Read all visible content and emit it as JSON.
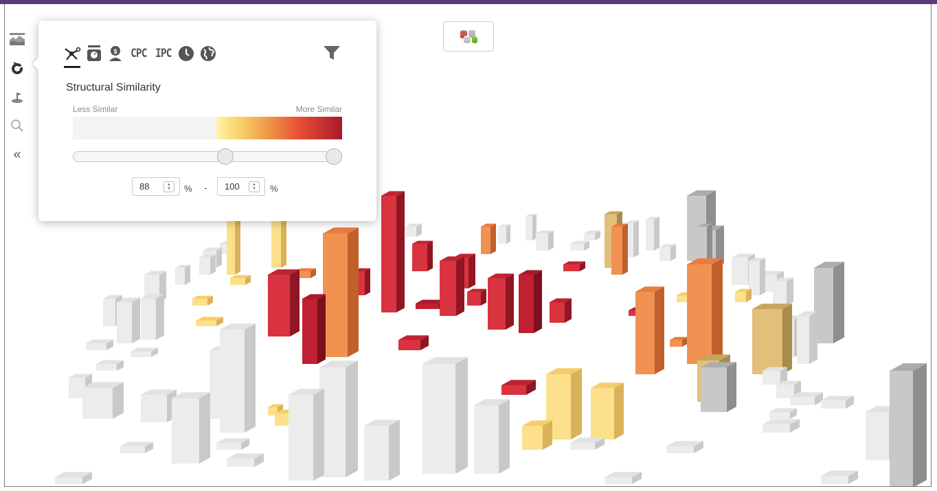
{
  "toolbar": {
    "left_rail": [
      "landscape-icon",
      "similarity-icon",
      "pin-icon",
      "search-icon",
      "collapse-icon"
    ],
    "collapse_glyph": "«"
  },
  "panel": {
    "tabs": [
      {
        "type": "icon",
        "icon": "molecule-structure-icon",
        "active": true
      },
      {
        "type": "icon",
        "icon": "weight-scale-icon"
      },
      {
        "type": "icon",
        "icon": "applicant-icon"
      },
      {
        "type": "text",
        "label": "CPC"
      },
      {
        "type": "text",
        "label": "IPC"
      },
      {
        "type": "icon",
        "icon": "clock-icon"
      },
      {
        "type": "icon",
        "icon": "globe-icon"
      }
    ],
    "filter_icon": "funnel-icon",
    "title": "Structural Similarity",
    "legend_left": "Less Similar",
    "legend_right": "More Similar",
    "colors": {
      "low": "#fdf3a8",
      "mid": "#f09448",
      "high": "#a8192b",
      "neutral": "#f3f3f3"
    },
    "slider": {
      "min_percent": 88,
      "max_percent": 100
    },
    "range_from": "88",
    "range_to": "100",
    "unit": "%",
    "separator": "-"
  },
  "db_button_icon": "database-stack-icon"
}
